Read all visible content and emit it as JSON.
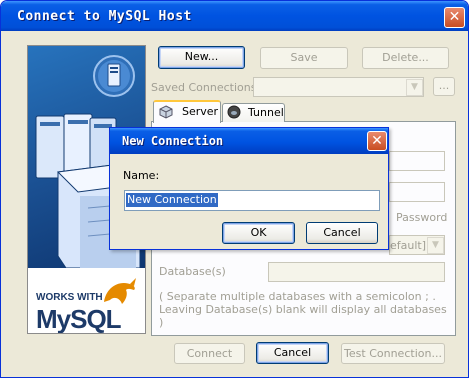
{
  "window": {
    "title": "Connect to MySQL Host"
  },
  "branding": {
    "works_with": "WORKS WITH",
    "logo_text": "MySQL"
  },
  "toolbar": {
    "new_label": "New...",
    "save_label": "Save",
    "delete_label": "Delete..."
  },
  "saved_connections": {
    "label": "Saved Connections:",
    "value": "",
    "browse_label": "..."
  },
  "tabs": [
    {
      "label": "Server",
      "icon": "server-cube-icon",
      "active": true
    },
    {
      "label": "Tunnel",
      "icon": "tunnel-icon",
      "active": false
    }
  ],
  "server_tab": {
    "password_label_partial": "Password",
    "default_partial": "efault]",
    "databases_label": "Database(s)",
    "databases_value": "",
    "hint": "( Separate multiple databases with a semicolon ; . Leaving Database(s) blank will display all databases )"
  },
  "footer": {
    "connect_label": "Connect",
    "cancel_label": "Cancel",
    "test_label": "Test Connection..."
  },
  "dialog": {
    "title": "New Connection",
    "name_label": "Name:",
    "name_value": "New Connection",
    "ok_label": "OK",
    "cancel_label": "Cancel"
  },
  "colors": {
    "title_blue": "#0053e1",
    "close_red": "#c94d22",
    "selection": "#316ac5",
    "face": "#ece9d8"
  }
}
